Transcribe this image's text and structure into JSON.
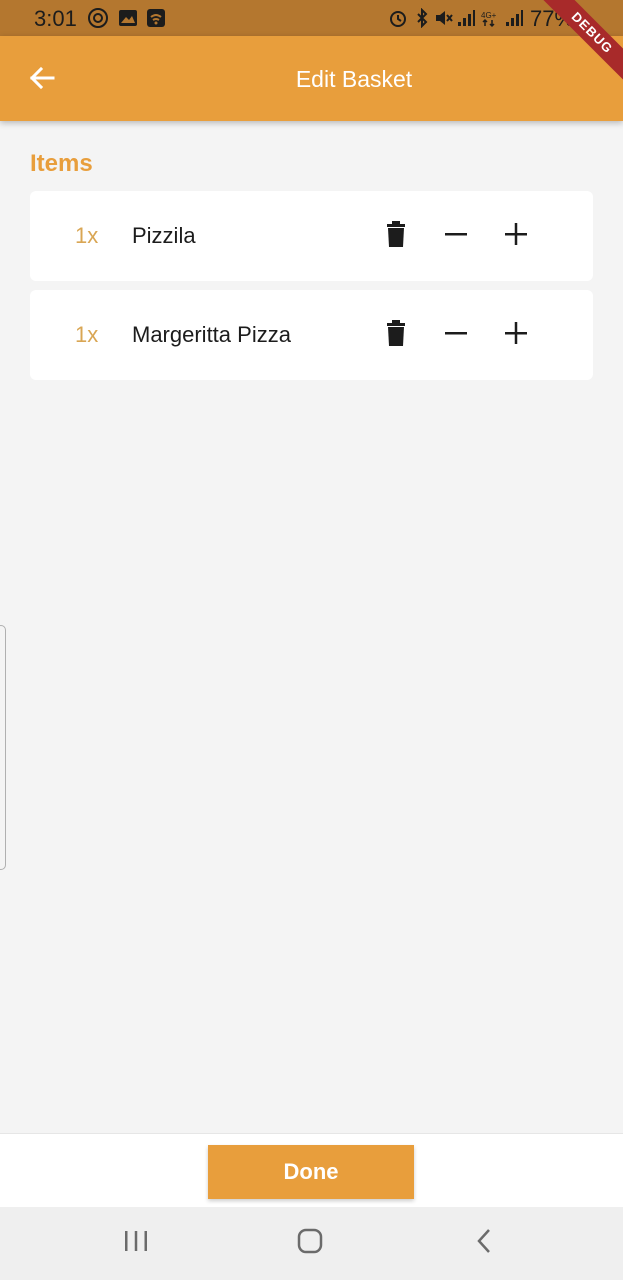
{
  "status_bar": {
    "time": "3:01",
    "battery": "77%",
    "icons": [
      "messenger-icon",
      "gallery-icon",
      "wifi-icon",
      "alarm-icon",
      "bluetooth-icon",
      "mute-icon",
      "signal-icon",
      "4g-icon",
      "signal-icon"
    ]
  },
  "debug_ribbon": "DEBUG",
  "app_bar": {
    "title": "Edit Basket",
    "back_icon": "arrow-left-icon"
  },
  "section": {
    "heading": "Items"
  },
  "items": [
    {
      "quantity": "1x",
      "name": "Pizzila"
    },
    {
      "quantity": "1x",
      "name": "Margeritta Pizza"
    }
  ],
  "bottom": {
    "done_label": "Done"
  },
  "nav": {
    "recent_icon": "recent-apps-icon",
    "home_icon": "home-icon",
    "back_icon": "nav-back-icon"
  },
  "colors": {
    "accent": "#e89e3c",
    "status_bar": "#b4772f",
    "quantity_text": "#d9a654",
    "background": "#f4f4f4"
  }
}
